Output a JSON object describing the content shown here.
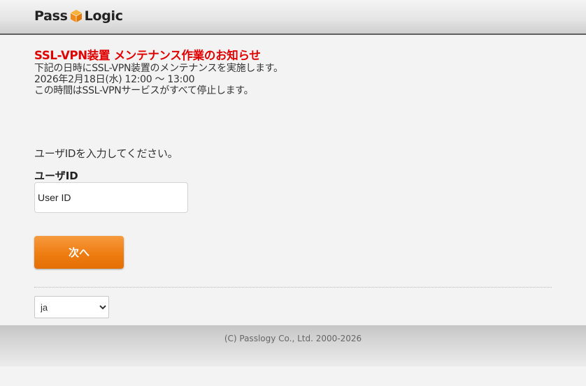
{
  "header": {
    "logo_left": "Pass",
    "logo_right": "Logic"
  },
  "notice": {
    "title": "SSL-VPN装置 メンテナンス作業のお知らせ",
    "lines": [
      "下記の日時にSSL-VPN装置のメンテナンスを実施します。",
      "2026年2月18日(水) 12:00 ～ 13:00",
      "この時間はSSL-VPNサービスがすべて停止します。"
    ]
  },
  "login": {
    "prompt": "ユーザIDを入力してください。",
    "userid_label": "ユーザID",
    "userid_placeholder": "User ID",
    "userid_value": "",
    "next_button": "次へ"
  },
  "language": {
    "selected": "ja"
  },
  "footer": {
    "copyright": "(C) Passlogy Co., Ltd. 2000-2026"
  },
  "colors": {
    "notice_title": "#e00000",
    "button": "#ee7d12",
    "logo_cube": "#f0a020"
  },
  "icons": {
    "logo": "cube-icon",
    "select": "chevron-down-icon"
  }
}
